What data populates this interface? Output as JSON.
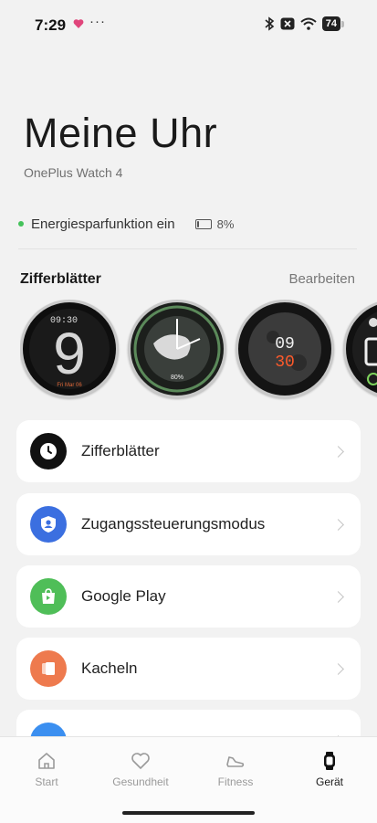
{
  "status_bar": {
    "time": "7:29",
    "dots": "···",
    "battery": "74",
    "icons": [
      "heart-icon",
      "bluetooth-icon",
      "x-box-icon",
      "wifi-icon",
      "battery-icon"
    ]
  },
  "header": {
    "title": "Meine Uhr",
    "subtitle": "OnePlus Watch 4"
  },
  "energy": {
    "label": "Energiesparfunktion ein",
    "battery_percent": "8%",
    "dot_color": "#44c25a"
  },
  "watch_faces": {
    "title": "Zifferblätter",
    "edit_label": "Bearbeiten",
    "faces": [
      {
        "name": "face-digital-9",
        "time_text": "09:30",
        "numeral": "9",
        "footer": "Fri Mar 06"
      },
      {
        "name": "face-globe",
        "center_value": "80%"
      },
      {
        "name": "face-moon",
        "hour": "09",
        "minute": "30",
        "minute_color": "#ff5a2b"
      },
      {
        "name": "face-partial"
      }
    ]
  },
  "menu": [
    {
      "label": "Zifferblätter",
      "icon": "clock-icon",
      "color": "#111111"
    },
    {
      "label": "Zugangssteuerungsmodus",
      "icon": "person-shield-icon",
      "color": "#3b6fe0"
    },
    {
      "label": "Google Play",
      "icon": "shopping-bag-icon",
      "color": "#4fbe58"
    },
    {
      "label": "Kacheln",
      "icon": "tiles-icon",
      "color": "#ee7a4e"
    },
    {
      "label": "",
      "icon": "partial-icon",
      "color": "#3b8ff0"
    }
  ],
  "bottom_nav": [
    {
      "label": "Start",
      "icon": "home-icon",
      "active": false
    },
    {
      "label": "Gesundheit",
      "icon": "heart-outline-icon",
      "active": false
    },
    {
      "label": "Fitness",
      "icon": "shoe-icon",
      "active": false
    },
    {
      "label": "Gerät",
      "icon": "watch-icon",
      "active": true
    }
  ]
}
